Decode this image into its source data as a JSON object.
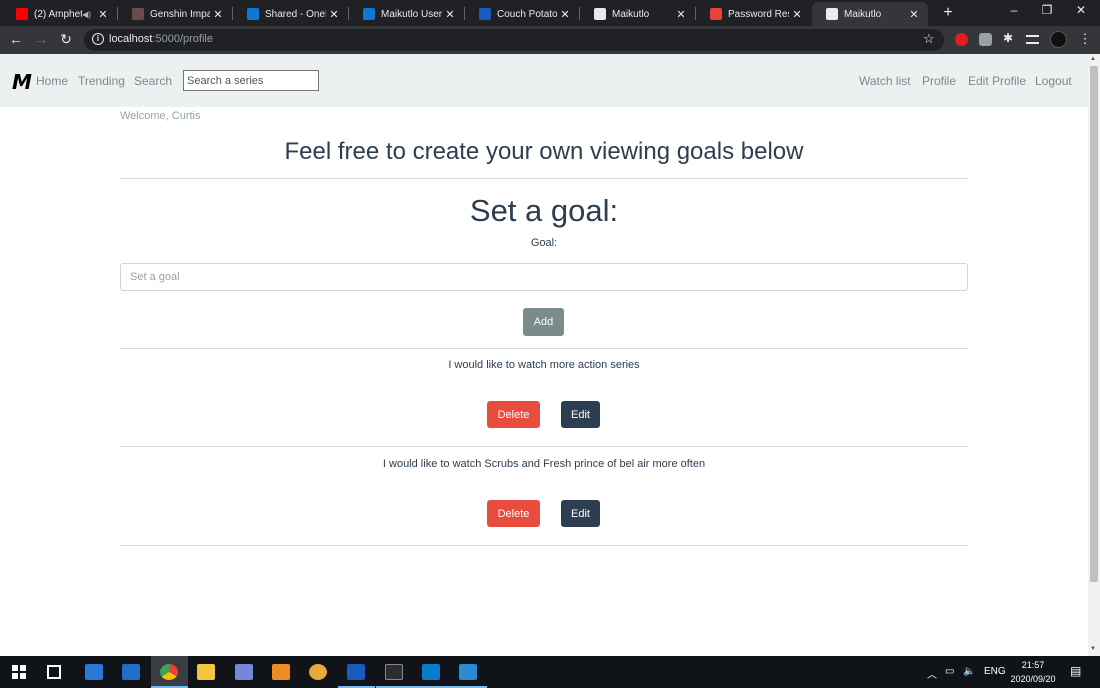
{
  "browser": {
    "tabs": [
      {
        "title": "(2) Amphet",
        "favicon": "youtube-icon",
        "color": "#ff0000",
        "audio": true
      },
      {
        "title": "Genshin Impact",
        "favicon": "genshin-icon",
        "color": "#6a4c4c"
      },
      {
        "title": "Shared - OneDr",
        "favicon": "onedrive-icon",
        "color": "#0f78d4"
      },
      {
        "title": "Maikutlo User M",
        "favicon": "onedrive-icon",
        "color": "#0f78d4"
      },
      {
        "title": "Couch Potatoes",
        "favicon": "word-icon",
        "color": "#185abd"
      },
      {
        "title": "Maikutlo",
        "favicon": "globe-icon",
        "color": "#e8eaed"
      },
      {
        "title": "Password Reset",
        "favicon": "gmail-icon",
        "color": "#ea4335"
      },
      {
        "title": "Maikutlo",
        "favicon": "globe-icon",
        "color": "#e8eaed",
        "active": true
      }
    ],
    "close_glyph": "✕",
    "new_tab_glyph": "+",
    "url_host": "localhost",
    "url_path": ":5000/profile",
    "window_controls": {
      "minimize": "–",
      "restore": "❐",
      "close": "✕"
    }
  },
  "nav": {
    "logo": "M",
    "links_left": [
      "Home",
      "Trending",
      "Search"
    ],
    "search_placeholder": "Search a series",
    "links_right": [
      "Watch list",
      "Profile",
      "Edit Profile",
      "Logout"
    ]
  },
  "page": {
    "welcome": "Welcome, Curtis",
    "title": "Feel free to create your own viewing goals below",
    "set_goal_heading": "Set a goal:",
    "goal_label": "Goal:",
    "goal_placeholder": "Set a goal",
    "add_button": "Add",
    "goals": [
      {
        "text": "I would like to watch more action series",
        "delete_label": "Delete",
        "edit_label": "Edit"
      },
      {
        "text": "I would like to watch Scrubs and Fresh prince of bel air more often",
        "delete_label": "Delete",
        "edit_label": "Edit"
      }
    ]
  },
  "colors": {
    "nav_bg": "#ecf0f1",
    "primary_text": "#2c3e50",
    "muted_text": "#7b8a8b",
    "danger": "#e74c3c",
    "secondary": "#7b8a8b",
    "dark": "#2c3e50"
  },
  "taskbar": {
    "apps": [
      "start-icon",
      "task-view-icon",
      "store-icon",
      "mail-icon",
      "chrome-icon",
      "file-explorer-icon",
      "discord-icon",
      "media-player-icon",
      "security-icon",
      "word-icon",
      "terminal-icon",
      "vscode-icon",
      "photos-icon"
    ],
    "language": "ENG",
    "time": "21:57",
    "date": "2020/09/20"
  }
}
